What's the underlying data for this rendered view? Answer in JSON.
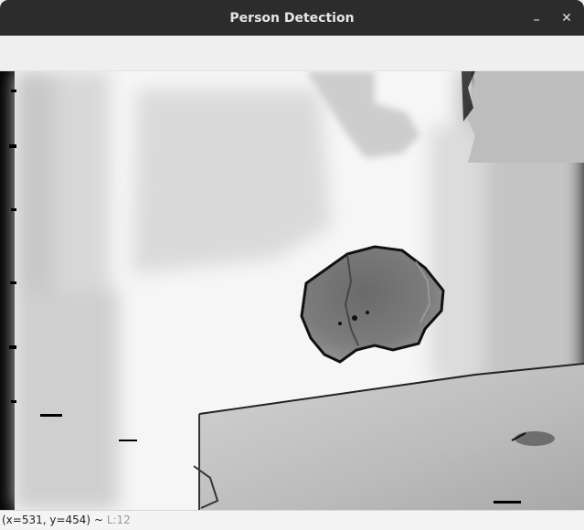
{
  "window": {
    "title": "Person Detection",
    "minimize_glyph": "–",
    "close_glyph": "✕"
  },
  "image": {
    "description_kind": "depth-map",
    "colors": {
      "background": "#000000",
      "bright": "#ffffff",
      "object": "#6e6e6e"
    }
  },
  "statusbar": {
    "coords": "(x=531, y=454)",
    "separator": " ~ ",
    "pixel_value": "L:12"
  }
}
